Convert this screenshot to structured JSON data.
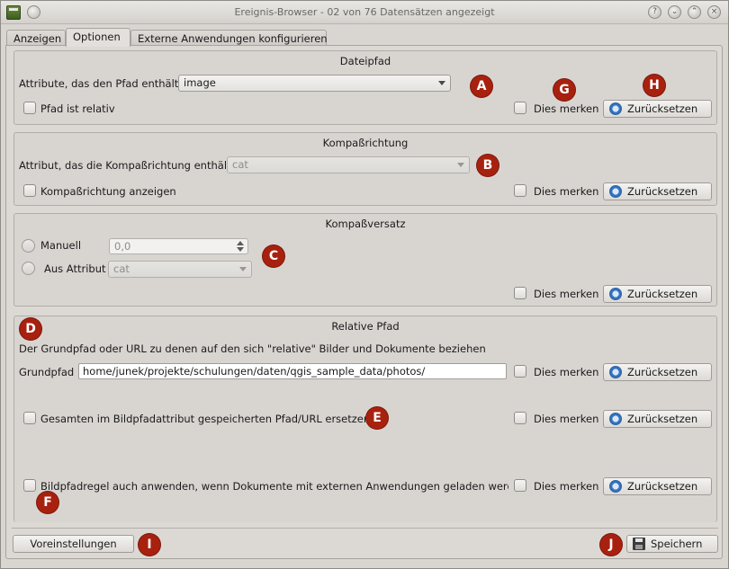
{
  "window": {
    "title": "Ereignis-Browser - 02 von 76 Datensätzen angezeigt",
    "controls": [
      "?",
      "⌄",
      "⌃",
      "×"
    ]
  },
  "tabs": [
    {
      "label": "Anzeigen",
      "active": false
    },
    {
      "label": "Optionen",
      "active": true
    },
    {
      "label": "Externe Anwendungen konfigurieren",
      "active": false
    }
  ],
  "remember_label": "Dies merken",
  "reset_label": "Zurücksetzen",
  "dateipfad": {
    "title": "Dateipfad",
    "attribute_label": "Attribute, das den Pfad enthält",
    "attribute_value": "image",
    "relative_label": "Pfad ist relativ"
  },
  "kompassrichtung": {
    "title": "Kompaßrichtung",
    "attribute_label": "Attribut, das die Kompaßrichtung enthält",
    "attribute_value": "cat",
    "show_label": "Kompaßrichtung anzeigen"
  },
  "kompassversatz": {
    "title": "Kompaßversatz",
    "manual_label": "Manuell",
    "manual_value": "0,0",
    "from_attribute_label": "Aus Attribut",
    "from_attribute_value": "cat"
  },
  "relativepfad": {
    "title": "Relative Pfad",
    "description": "Der Grundpfad oder URL zu denen auf den sich \"relative\" Bilder und Dokumente beziehen",
    "base_label": "Grundpfad",
    "base_value": "home/junek/projekte/schulungen/daten/qgis_sample_data/photos/",
    "replace_label": "Gesamten im Bildpfadattribut gespeicherten Pfad/URL ersetzen",
    "apply_label": "Bildpfadregel auch anwenden, wenn Dokumente mit externen Anwendungen geladen werden"
  },
  "footer": {
    "defaults_label": "Voreinstellungen",
    "save_label": "Speichern"
  },
  "markers": {
    "a": "A",
    "b": "B",
    "c": "C",
    "d": "D",
    "e": "E",
    "f": "F",
    "g": "G",
    "h": "H",
    "i": "I",
    "j": "J"
  },
  "colors": {
    "marker": "#a8210f",
    "window_bg": "#d9d6d2"
  }
}
